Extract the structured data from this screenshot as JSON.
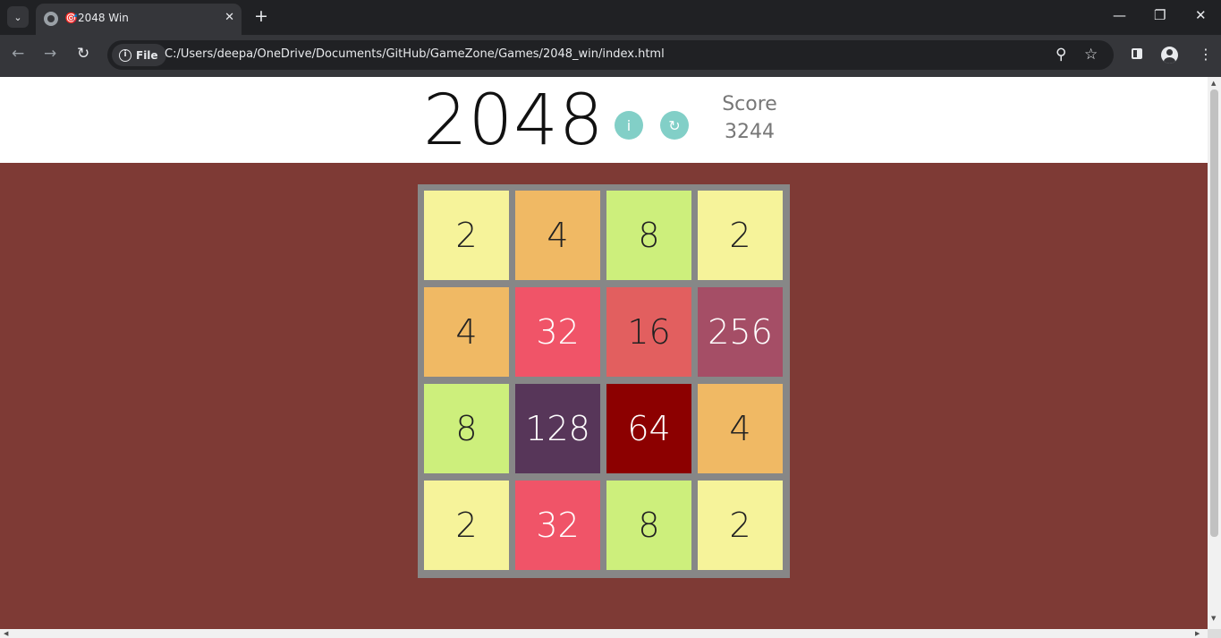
{
  "browser": {
    "tab_title": "🎯2048 Win",
    "new_tab_label": "+",
    "tab_close_label": "✕",
    "url_chip_label": "File",
    "url": "C:/Users/deepa/OneDrive/Documents/GitHub/GameZone/Games/2048_win/index.html"
  },
  "game": {
    "title": "2048",
    "info_button_label": "i",
    "restart_button_label": "↻",
    "score_label": "Score",
    "score_value": "3244"
  },
  "board": {
    "rows": [
      [
        {
          "label": "2",
          "bg": "#f6f39a",
          "fg": "#222222"
        },
        {
          "label": "4",
          "bg": "#f0b964",
          "fg": "#222222"
        },
        {
          "label": "8",
          "bg": "#cdef7c",
          "fg": "#222222"
        },
        {
          "label": "2",
          "bg": "#f6f39a",
          "fg": "#222222"
        }
      ],
      [
        {
          "label": "4",
          "bg": "#f0b964",
          "fg": "#222222"
        },
        {
          "label": "32",
          "bg": "#f05468",
          "fg": "#ffffff"
        },
        {
          "label": "16",
          "bg": "#e25f5f",
          "fg": "#222222"
        },
        {
          "label": "256",
          "bg": "#a54e66",
          "fg": "#ffffff"
        }
      ],
      [
        {
          "label": "8",
          "bg": "#cdef7c",
          "fg": "#222222"
        },
        {
          "label": "128",
          "bg": "#573659",
          "fg": "#ffffff"
        },
        {
          "label": "64",
          "bg": "#8c0000",
          "fg": "#ffffff"
        },
        {
          "label": "4",
          "bg": "#f0b964",
          "fg": "#222222"
        }
      ],
      [
        {
          "label": "2",
          "bg": "#f6f39a",
          "fg": "#222222"
        },
        {
          "label": "32",
          "bg": "#f05468",
          "fg": "#ffffff"
        },
        {
          "label": "8",
          "bg": "#cdef7c",
          "fg": "#222222"
        },
        {
          "label": "2",
          "bg": "#f6f39a",
          "fg": "#222222"
        }
      ]
    ]
  },
  "colors": {
    "page_background": "#7e3a35",
    "header_background": "#ffffff",
    "board_background": "#878787",
    "accent_button": "#82cfc7"
  },
  "icons": [
    "tab-search-icon",
    "globe-icon",
    "close-icon",
    "back-icon",
    "forward-icon",
    "reload-icon",
    "info-icon",
    "zoom-icon",
    "star-icon",
    "side-panel-icon",
    "profile-icon",
    "menu-icon",
    "minimize-icon",
    "restore-icon"
  ]
}
